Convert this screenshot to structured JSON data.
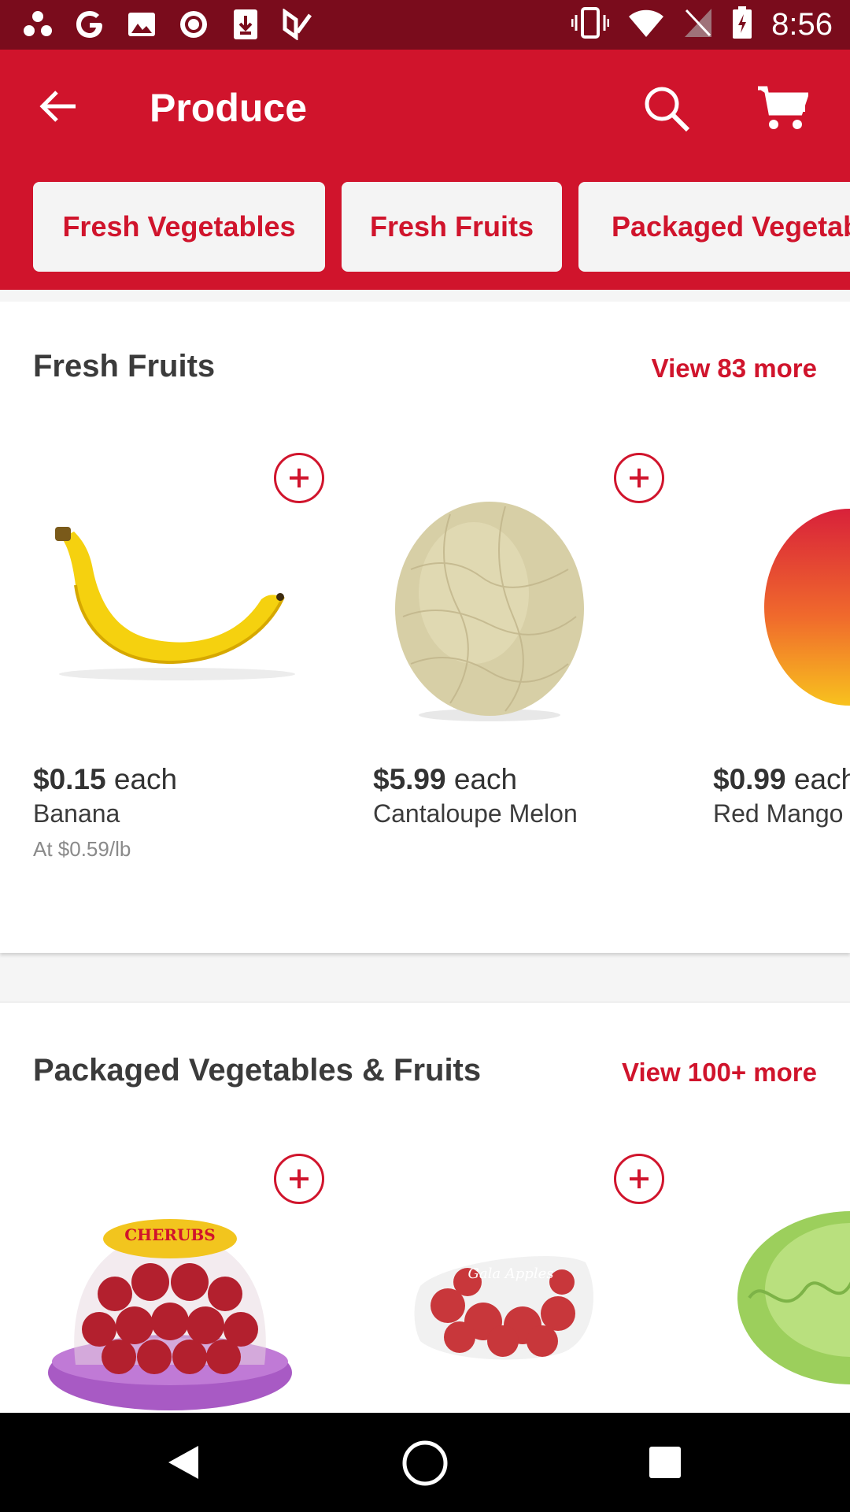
{
  "status_bar": {
    "time": "8:56",
    "left_icons": [
      "dots-icon",
      "google-icon",
      "image-icon",
      "record-icon",
      "download-icon",
      "check-icon"
    ],
    "right_icons": [
      "vibrate-icon",
      "wifi-icon",
      "no-signal-icon",
      "battery-icon"
    ]
  },
  "app_bar": {
    "title": "Produce",
    "back_icon": "arrow-left-icon",
    "search_icon": "search-icon",
    "cart_icon": "cart-icon"
  },
  "categories": [
    "Fresh Vegetables",
    "Fresh Fruits",
    "Packaged Vegetab"
  ],
  "sections": [
    {
      "title": "Fresh Fruits",
      "view_more": "View 83 more",
      "products": [
        {
          "price": "$0.15",
          "price_unit": " each",
          "name": "Banana",
          "unit_price": "At $0.59/lb"
        },
        {
          "price": "$5.99",
          "price_unit": " each",
          "name": "Cantaloupe Melon",
          "unit_price": ""
        },
        {
          "price": "$0.99",
          "price_unit": " each",
          "name": "Red Mango",
          "unit_price": ""
        }
      ]
    },
    {
      "title": "Packaged Vegetables & Fruits",
      "view_more": "View 100+ more",
      "products": [
        {
          "label_top": "CHERUBS"
        },
        {
          "label_top": "Gala Apples"
        },
        {
          "label_top": ""
        }
      ]
    }
  ],
  "colors": {
    "brand": "#d0142c",
    "status_bar": "#7a0c1c",
    "chip_bg": "#f4f4f4"
  }
}
